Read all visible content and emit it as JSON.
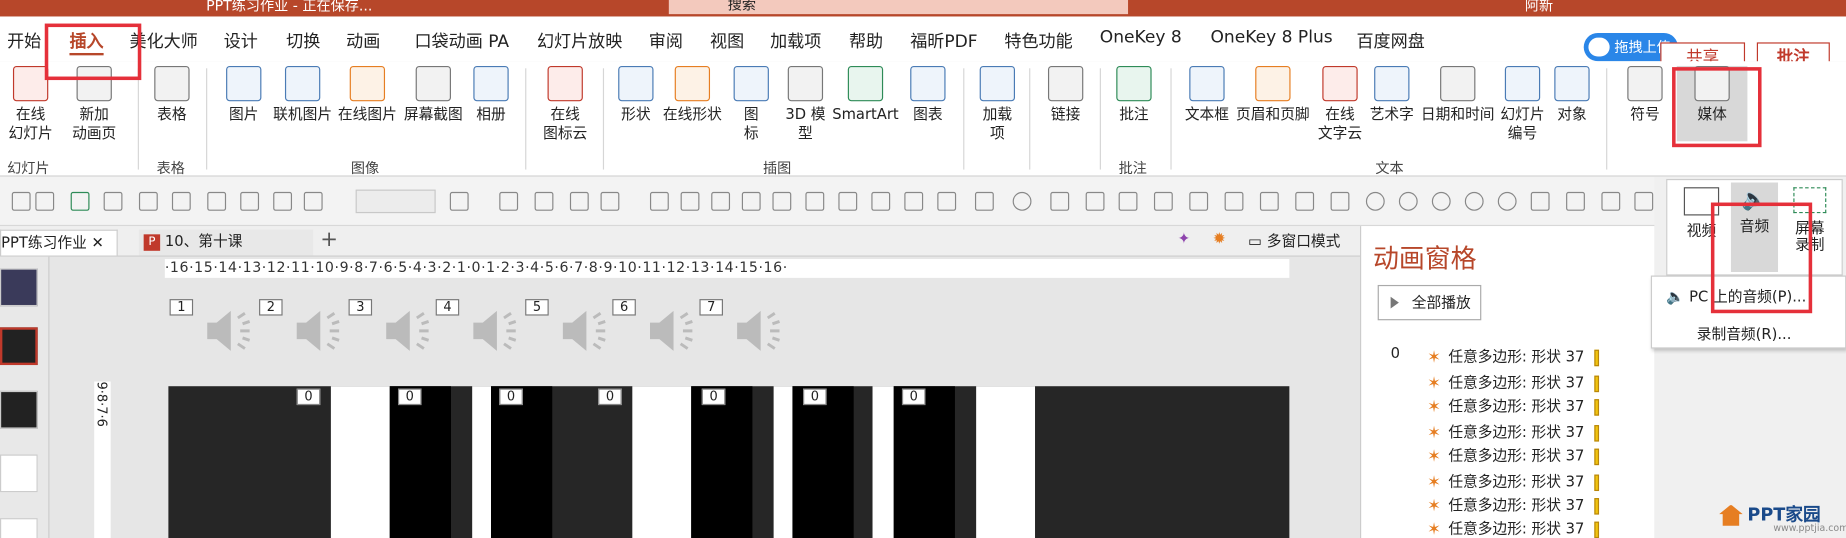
{
  "title": {
    "text": "PPT练习作业 - 正在保存...",
    "search_placeholder": "搜索",
    "user": "阿新"
  },
  "tabs": [
    "开始",
    "插入",
    "美化大师",
    "设计",
    "切换",
    "动画",
    "口袋动画 PA",
    "幻灯片放映",
    "审阅",
    "视图",
    "加载项",
    "帮助",
    "福昕PDF",
    "特色功能",
    "OneKey 8",
    "OneKey 8 Plus",
    "百度网盘"
  ],
  "active_tab": "插入",
  "share": {
    "upload": "拖拽上传",
    "share": "共享",
    "comment": "批注"
  },
  "ribbon": {
    "buttons": [
      "在线\n幻灯片",
      "新加\n动画页",
      "表格",
      "图片",
      "联机图片",
      "在线图片",
      "屏幕截图",
      "相册",
      "在线\n图标云",
      "形状",
      "在线形状",
      "图\n标",
      "3D 模\n型",
      "SmartArt",
      "图表",
      "加载\n项",
      "链接",
      "批注",
      "文本框",
      "页眉和页脚",
      "在线\n文字云",
      "艺术字",
      "日期和时间",
      "幻灯片\n编号",
      "对象",
      "符号",
      "媒体"
    ],
    "groups": [
      "幻灯片",
      "表格",
      "图像",
      "插图",
      "批注",
      "文本"
    ]
  },
  "doc_tabs": {
    "tab1": "PPT练习作业",
    "tab2": "10、第十课",
    "add": "+",
    "multiwin": "多窗口模式"
  },
  "ruler": "·16·15·14·13·12·11·10·9·8·7·6·5·4·3·2·1·0·1·2·3·4·5·6·7·8·9·10·11·12·13·14·15·16·",
  "vruler": "9·8·7·6",
  "slide": {
    "audio_numbers": [
      "1",
      "2",
      "3",
      "4",
      "5",
      "6",
      "7"
    ],
    "key_labels": [
      "0",
      "0",
      "0",
      "0",
      "0",
      "0",
      "0"
    ]
  },
  "anim_pane": {
    "title": "动画窗格",
    "play_all": "全部播放",
    "zero": "0",
    "items": [
      "任意多边形: 形状 37",
      "任意多边形: 形状 37",
      "任意多边形: 形状 37",
      "任意多边形: 形状 37",
      "任意多边形: 形状 37",
      "任意多边形: 形状 37",
      "任意多边形: 形状 37",
      "任意多边形: 形状 37"
    ]
  },
  "media_dropdown": {
    "video": "视频",
    "audio": "音频",
    "screen": "屏幕\n录制"
  },
  "audio_menu": {
    "pc": "PC 上的音频(P)...",
    "record": "录制音频(R)..."
  },
  "watermark": {
    "brand": "PPT家园",
    "url": "www.pptjia.com"
  }
}
